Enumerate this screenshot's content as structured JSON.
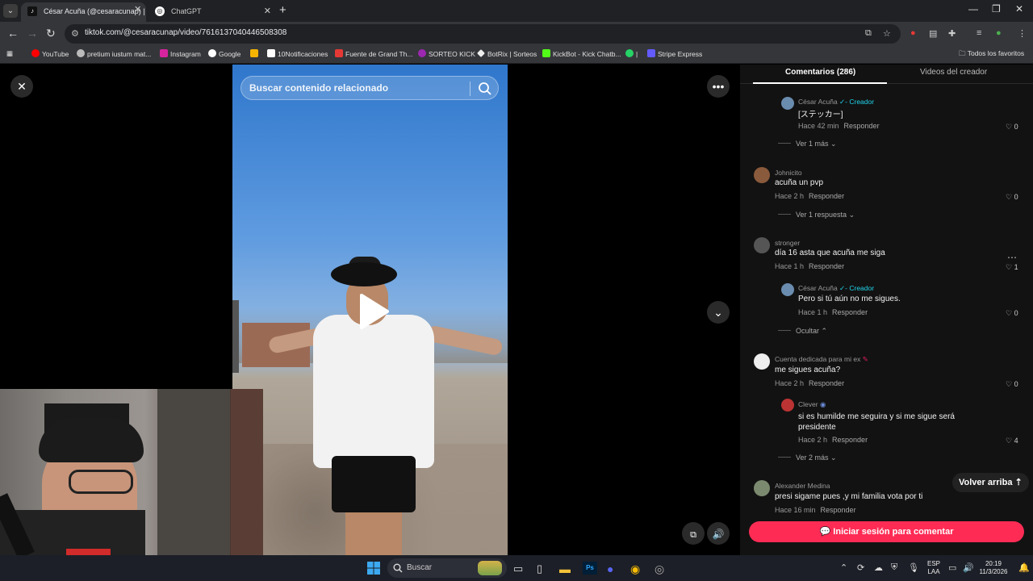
{
  "browser": {
    "tabs": [
      {
        "label": "César Acuña (@cesaracunap) | T",
        "active": true
      },
      {
        "label": "ChatGPT",
        "active": false
      }
    ],
    "url": "tiktok.com/@cesaracunap/video/7616137040446508308",
    "bookmarks": [
      {
        "label": "YouTube",
        "color": "#ff0000"
      },
      {
        "label": "pretium iustum mat...",
        "color": "#bbbbbb"
      },
      {
        "label": "Instagram",
        "color": "#d6249f"
      },
      {
        "label": "Google",
        "color": "#4285f4"
      },
      {
        "label": "",
        "color": "#f4b400"
      },
      {
        "label": "10Notificaciones",
        "color": "#ffffff"
      },
      {
        "label": "Fuente de Grand Th...",
        "color": "#e53935"
      },
      {
        "label": "SORTEO KICK",
        "color": "#9c27b0"
      },
      {
        "label": "BotRix | Sorteos",
        "color": "#eeeeee"
      },
      {
        "label": "KickBot - Kick Chatb...",
        "color": "#53fc18"
      },
      {
        "label": "|",
        "color": "#25d366"
      },
      {
        "label": "Stripe Express",
        "color": "#635bff"
      }
    ],
    "all_bookmarks": "Todos los favoritos"
  },
  "video": {
    "search_placeholder": "Buscar contenido relacionado"
  },
  "comments": {
    "tab_comments": "Comentarios (286)",
    "tab_creator_videos": "Videos del creador",
    "items": [
      {
        "name": "César Acuña",
        "creator_tag": "- Creador",
        "text": "[ステッカー]",
        "time": "Hace 42 min",
        "reply": "Responder",
        "likes": "0"
      },
      {
        "more": "Ver 1 más"
      },
      {
        "name": "Johnicito",
        "text": "acuña un pvp",
        "time": "Hace 2 h",
        "reply": "Responder",
        "likes": "0"
      },
      {
        "more": "Ver 1 respuesta"
      },
      {
        "name": "stronger",
        "text": "día 16 asta que acuña me siga",
        "time": "Hace 1 h",
        "reply": "Responder",
        "likes": "1"
      },
      {
        "name": "César Acuña",
        "creator_tag": "- Creador",
        "text": "Pero si tú aún no me sigues.",
        "time": "Hace 1 h",
        "reply": "Responder",
        "likes": "0"
      },
      {
        "more": "Ocultar"
      },
      {
        "name": "Cuenta dedicada para mi ex",
        "text": "me sigues acuña?",
        "time": "Hace 2 h",
        "reply": "Responder",
        "likes": "0"
      },
      {
        "name": "Clever",
        "text": "si es humilde me seguira y si me sigue será presidente",
        "time": "Hace 2 h",
        "reply": "Responder",
        "likes": "4"
      },
      {
        "more": "Ver 2 más"
      },
      {
        "name": "Alexander Medina",
        "text": "presi sigame pues ,y mi familia vota por ti",
        "time": "Hace 16 min",
        "reply": "Responder",
        "likes": "0"
      }
    ],
    "back_to_top": "Volver arriba",
    "login_to_comment": "Iniciar sesión para comentar"
  },
  "taskbar": {
    "search_label": "Buscar",
    "lang": "ESP",
    "lang2": "LAA",
    "time": "20:19",
    "date": "11/3/2026"
  }
}
